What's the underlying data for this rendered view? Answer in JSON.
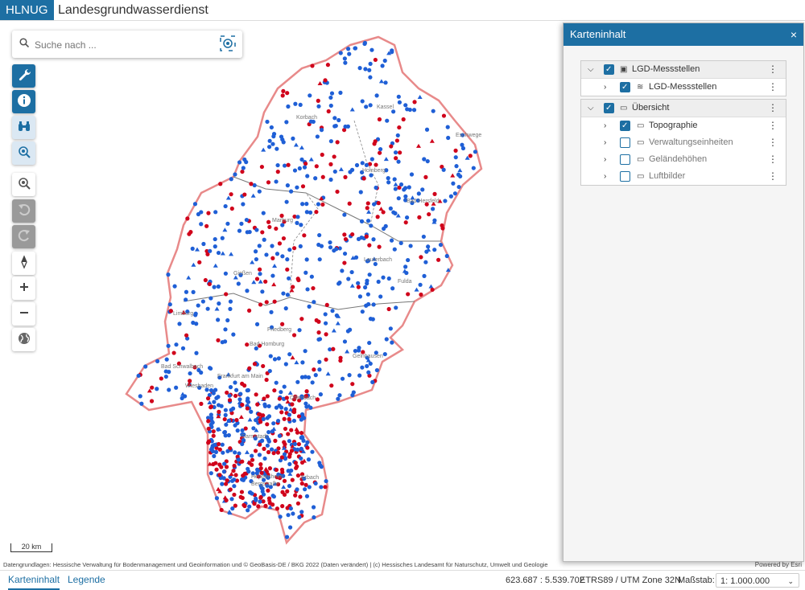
{
  "header": {
    "logo": "HLNUG",
    "title": "Landesgrundwasserdienst"
  },
  "search": {
    "placeholder": "Suche nach ..."
  },
  "toolbar": [
    {
      "name": "wrench-tool",
      "icon": "wrench-icon"
    },
    {
      "name": "info-tool",
      "icon": "info-icon"
    },
    {
      "name": "binoculars-tool",
      "icon": "binoculars-icon"
    },
    {
      "name": "zoom-layer-tool",
      "icon": "zoom-extent-icon"
    },
    {
      "name": "zoom-full-tool",
      "icon": "zoom-full-icon"
    },
    {
      "name": "undo-view-tool",
      "icon": "undo-icon"
    },
    {
      "name": "redo-view-tool",
      "icon": "redo-icon"
    },
    {
      "name": "north-arrow-tool",
      "icon": "compass-icon"
    },
    {
      "name": "zoom-in-tool",
      "icon": "plus-icon"
    },
    {
      "name": "zoom-out-tool",
      "icon": "minus-icon"
    },
    {
      "name": "basemap-tool",
      "icon": "globe-icon"
    }
  ],
  "map": {
    "place_labels": [
      "Korbach",
      "Kassel",
      "Eschwege",
      "Homberg",
      "Bad Hersfeld",
      "Marburg",
      "Lauterbach",
      "Gießen",
      "Fulda",
      "Limburg",
      "Friedberg",
      "Bad Homburg",
      "Gelnhausen",
      "Bad Schwalbach",
      "Wiesbaden",
      "Frankfurt am Main",
      "Offenbach",
      "Darmstadt",
      "Heppenheim",
      "Bergstraße",
      "Erbach"
    ],
    "scalebar": "20 km",
    "attribution": "Datengrundlagen: Hessische Verwaltung für Bodenmanagement und Geoinformation und © GeoBasis-DE / BKG 2022 (Daten verändert) | (c) Hessisches Landesamt für Naturschutz, Umwelt und Geologie",
    "powered_by": "Powered by Esri",
    "colors": {
      "outline": "#e88a8a",
      "blue": "#1f5fd6",
      "red": "#d0021b"
    }
  },
  "panel": {
    "title": "Karteninhalt",
    "close": "×",
    "group1": {
      "label": "LGD-Messstellen",
      "children": [
        {
          "label": "LGD-Messstellen",
          "checked": true
        }
      ]
    },
    "group2": {
      "label": "Übersicht",
      "children": [
        {
          "label": "Topographie",
          "checked": true
        },
        {
          "label": "Verwaltungseinheiten",
          "checked": false
        },
        {
          "label": "Geländehöhen",
          "checked": false
        },
        {
          "label": "Luftbilder",
          "checked": false
        }
      ]
    }
  },
  "footer": {
    "tabs": [
      "Karteninhalt",
      "Legende"
    ],
    "coordinates": "623.687 : 5.539.702",
    "crs": "ETRS89 / UTM Zone 32N",
    "scale_label": "Maßstab:",
    "scale_value": "1: 1.000.000"
  }
}
